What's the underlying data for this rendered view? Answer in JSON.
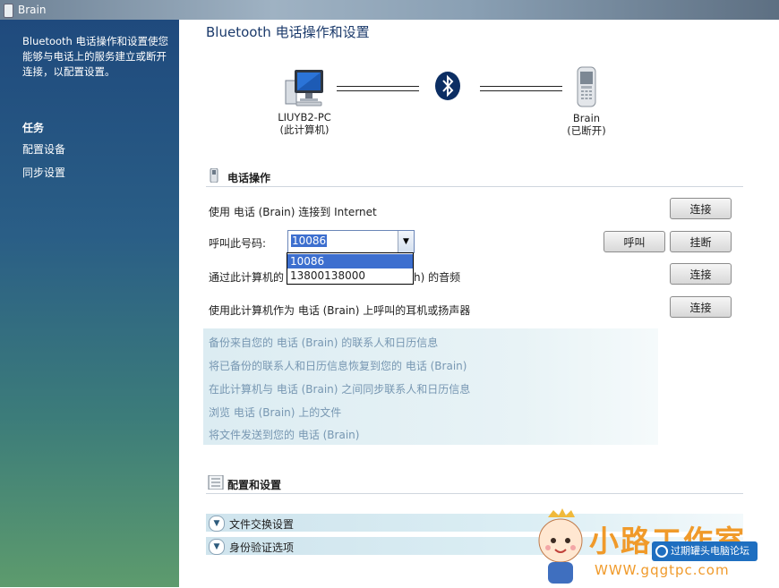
{
  "window": {
    "title": "Brain"
  },
  "sidebar": {
    "description": "Bluetooth 电话操作和设置使您能够与电话上的服务建立或断开连接，以配置设置。",
    "tasks_heading": "任务",
    "links": [
      "配置设备",
      "同步设置"
    ]
  },
  "header": {
    "title": "Bluetooth 电话操作和设置"
  },
  "devices": {
    "computer": {
      "name": "LIUYB2-PC",
      "note": "(此计算机)"
    },
    "phone": {
      "name": "Brain",
      "note": "(已断开)"
    }
  },
  "phone_ops": {
    "title": "电话操作",
    "internet_row": {
      "text": "使用 电话 (Brain) 连接到 Internet",
      "button": "连接"
    },
    "call_row": {
      "label": "呼叫此号码:",
      "value": "10086",
      "options": [
        "10086",
        "13800138000"
      ],
      "call_button": "呼叫",
      "hangup_button": "挂断"
    },
    "audio_row": {
      "text_left": "通过此计算机的",
      "text_right": "h) 的音频",
      "button": "连接"
    },
    "headset_row": {
      "text": "使用此计算机作为 电话 (Brain) 上呼叫的耳机或扬声器",
      "button": "连接"
    }
  },
  "sync_links": [
    "备份来自您的 电话 (Brain) 的联系人和日历信息",
    "将已备份的联系人和日历信息恢复到您的 电话 (Brain)",
    "在此计算机与 电话 (Brain) 之间同步联系人和日历信息",
    "浏览 电话 (Brain) 上的文件",
    "将文件发送到您的 电话 (Brain)"
  ],
  "config": {
    "title": "配置和设置",
    "expanders": [
      "文件交换设置",
      "身份验证选项"
    ]
  },
  "watermark": {
    "brand": "小路工作室",
    "badge": "过期罐头电脑论坛",
    "url": "WWW.gqgtpc.com"
  },
  "colors": {
    "sidebar_top": "#1f4a7d",
    "sidebar_bottom": "#5d9b6d",
    "selection": "#3d6fcf",
    "bluetooth": "#0c2e63"
  }
}
